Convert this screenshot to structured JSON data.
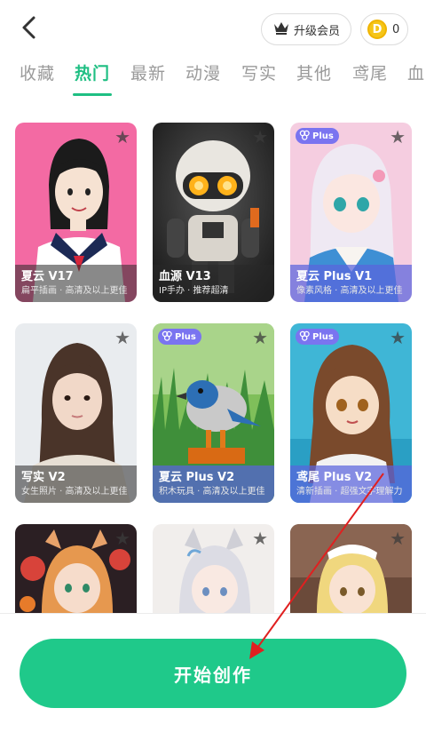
{
  "header": {
    "back_icon": "chevron-left-icon",
    "vip_label": "升级会员",
    "vip_icon": "crown-icon",
    "coin_icon_letter": "D",
    "coin_count": "0"
  },
  "tabs": [
    {
      "label": "收藏",
      "active": false
    },
    {
      "label": "热门",
      "active": true
    },
    {
      "label": "最新",
      "active": false
    },
    {
      "label": "动漫",
      "active": false
    },
    {
      "label": "写实",
      "active": false
    },
    {
      "label": "其他",
      "active": false
    },
    {
      "label": "鸢尾",
      "active": false
    },
    {
      "label": "血",
      "active": false
    }
  ],
  "cards": [
    {
      "title": "夏云 V17",
      "subtitle": "扁平插画 · 高清及以上更佳",
      "plus": false
    },
    {
      "title": "血源 V13",
      "subtitle": "IP手办 · 推荐超清",
      "plus": false
    },
    {
      "title": "夏云 Plus V1",
      "subtitle": "像素风格 · 高清及以上更佳",
      "plus": true
    },
    {
      "title": "写实 V2",
      "subtitle": "女生照片 · 高清及以上更佳",
      "plus": false
    },
    {
      "title": "夏云 Plus V2",
      "subtitle": "积木玩具 · 高清及以上更佳",
      "plus": true
    },
    {
      "title": "鸢尾 Plus V2",
      "subtitle": "清新插画 · 超强文字理解力",
      "plus": true
    },
    {
      "title": "",
      "subtitle": "",
      "plus": false
    },
    {
      "title": "",
      "subtitle": "",
      "plus": false
    },
    {
      "title": "",
      "subtitle": "",
      "plus": false
    }
  ],
  "plus_badge_label": "Plus",
  "start_button_label": "开始创作",
  "colors": {
    "accent": "#1fbf83",
    "button": "#1fc98a",
    "plus_badge": "#7a74f0",
    "annotation_arrow": "#e02020"
  }
}
